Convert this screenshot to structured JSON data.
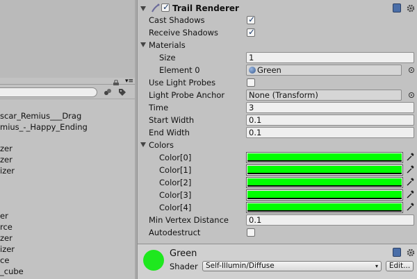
{
  "hierarchy": {
    "items": [
      "scar_Remius___Drag",
      "mius_-_Happy_Ending",
      "zer",
      "zer",
      "izer",
      "er",
      "rce",
      "zer",
      "izer",
      "ce",
      "_cube"
    ],
    "menu_glyph": "▾≡"
  },
  "component": {
    "title": "Trail Renderer",
    "enabled": true,
    "properties": {
      "cast_shadows": {
        "label": "Cast Shadows",
        "checked": true
      },
      "receive_shadows": {
        "label": "Receive Shadows",
        "checked": true
      },
      "materials": {
        "label": "Materials",
        "size_label": "Size",
        "size_value": "1",
        "element0_label": "Element 0",
        "element0_value": "Green"
      },
      "use_light_probes": {
        "label": "Use Light Probes",
        "checked": false
      },
      "light_probe_anchor": {
        "label": "Light Probe Anchor",
        "value": "None (Transform)"
      },
      "time": {
        "label": "Time",
        "value": "3"
      },
      "start_width": {
        "label": "Start Width",
        "value": "0.1"
      },
      "end_width": {
        "label": "End Width",
        "value": "0.1"
      },
      "colors": {
        "label": "Colors",
        "items": [
          {
            "label": "Color[0]",
            "color": "#00ff00"
          },
          {
            "label": "Color[1]",
            "color": "#00ff00"
          },
          {
            "label": "Color[2]",
            "color": "#00ff00"
          },
          {
            "label": "Color[3]",
            "color": "#00ff00"
          },
          {
            "label": "Color[4]",
            "color": "#00ff00"
          }
        ]
      },
      "min_vertex_distance": {
        "label": "Min Vertex Distance",
        "value": "0.1"
      },
      "autodestruct": {
        "label": "Autodestruct",
        "checked": false
      }
    }
  },
  "material": {
    "name": "Green",
    "color": "#1ee81e",
    "shader_label": "Shader",
    "shader_value": "Self-Illumin/Diffuse",
    "edit_label": "Edit..."
  }
}
